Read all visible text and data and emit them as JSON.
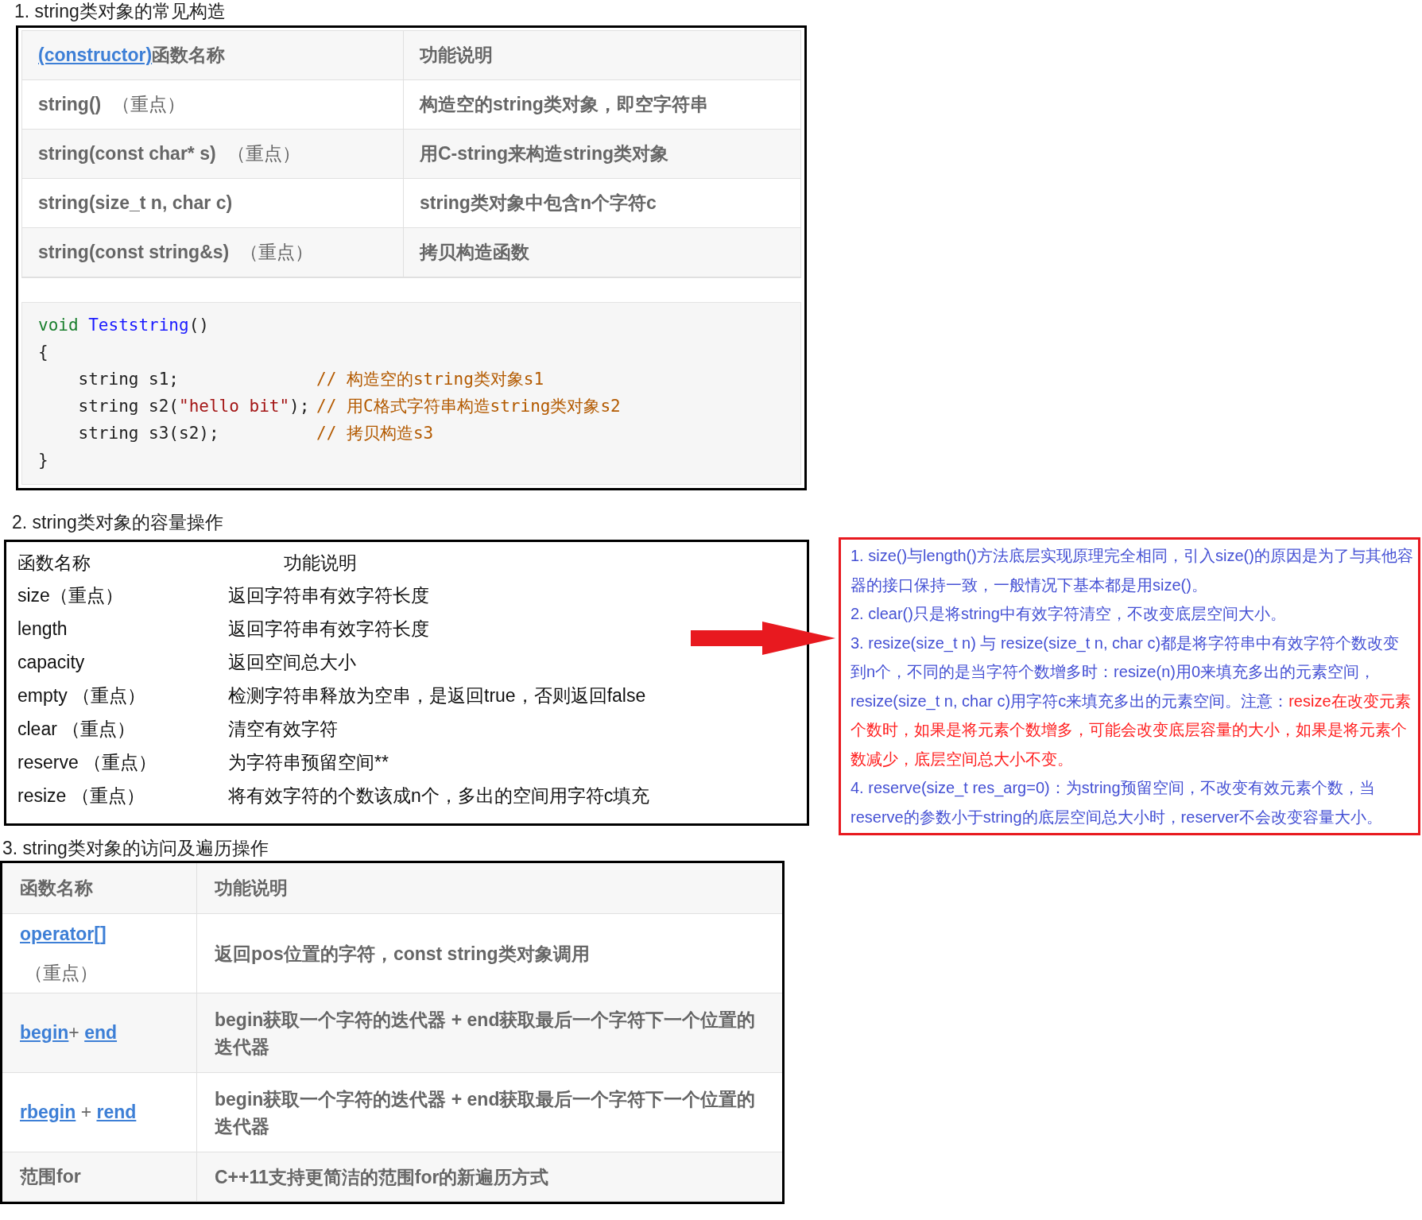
{
  "section_1": {
    "heading": "1. string类对象的常见构造",
    "table": {
      "header": {
        "link": "(constructor)",
        "name_rest": "函数名称",
        "description": "功能说明"
      },
      "rows": [
        {
          "name": "string()",
          "note": "（重点）",
          "description": "构造空的string类对象，即空字符串"
        },
        {
          "name": "string(const char* s)",
          "note": "（重点）",
          "description": "用C-string来构造string类对象"
        },
        {
          "name": "string(size_t n, char c)",
          "description": "string类对象中包含n个字符c"
        },
        {
          "name": "string(const string&s)",
          "note": "（重点）",
          "description": "拷贝构造函数"
        }
      ]
    },
    "code": [
      {
        "tokens": [
          {
            "kind": "keyword",
            "text": "void"
          },
          {
            "kind": "function",
            "text": "Teststring"
          },
          {
            "kind": "plain",
            "text": "()"
          }
        ]
      },
      {
        "tokens": [
          {
            "kind": "plain",
            "text": "{"
          }
        ]
      },
      {
        "tokens": [
          {
            "kind": "plain",
            "text": "    string s1;"
          }
        ],
        "comment": "// 构造空的string类对象s1"
      },
      {
        "tokens": [
          {
            "kind": "plain",
            "text": "    string s2("
          },
          {
            "kind": "string",
            "text": "\"hello bit\""
          },
          {
            "kind": "plain",
            "text": ");"
          }
        ],
        "comment": "// 用C格式字符串构造string类对象s2"
      },
      {
        "tokens": [
          {
            "kind": "plain",
            "text": "    string s3(s2);"
          }
        ],
        "comment": "// 拷贝构造s3"
      },
      {
        "tokens": [
          {
            "kind": "plain",
            "text": "}"
          }
        ]
      }
    ]
  },
  "section_2": {
    "heading": "2. string类对象的容量操作",
    "table": {
      "columns": [
        "函数名称",
        "功能说明"
      ],
      "rows": [
        {
          "name": "size（重点）",
          "description": "返回字符串有效字符长度"
        },
        {
          "name": "length",
          "description": "返回字符串有效字符长度"
        },
        {
          "name": "capacity",
          "description": "返回空间总大小"
        },
        {
          "name": "empty （重点）",
          "description": "检测字符串释放为空串，是返回true，否则返回false"
        },
        {
          "name": "clear （重点）",
          "description": "清空有效字符"
        },
        {
          "name": "reserve （重点）",
          "description": "为字符串预留空间**"
        },
        {
          "name": "resize （重点）",
          "description": "将有效字符的个数该成n个，多出的空间用字符c填充"
        }
      ]
    }
  },
  "notes": [
    {
      "segments": [
        {
          "text": "1. size()与length()方法底层实现原理完全相同，引入size()的原因是为了与其他容器的接口保持一致，一般情况下基本都是用size()。",
          "highlight": false
        }
      ]
    },
    {
      "segments": [
        {
          "text": "2. clear()只是将string中有效字符清空，不改变底层空间大小。",
          "highlight": false
        }
      ]
    },
    {
      "segments": [
        {
          "text": "3. resize(size_t n) 与 resize(size_t n, char c)都是将字符串中有效字符个数改变到n个，不同的是当字符个数增多时：resize(n)用0来填充多出的元素空间，resize(size_t n, char c)用字符c来填充多出的元素空间。注意：",
          "highlight": false
        },
        {
          "text": "resize在改变元素个数时，如果是将元素个数增多，可能会改变底层容量的大小，如果是将元素个数减少，底层空间总大小不变。",
          "highlight": true
        }
      ]
    },
    {
      "segments": [
        {
          "text": "4. reserve(size_t res_arg=0)：为string预留空间，不改变有效元素个数，当reserve的参数小于string的底层空间总大小时，reserver不会改变容量大小。",
          "highlight": false
        }
      ]
    }
  ],
  "section_3": {
    "heading": "3. string类对象的访问及遍历操作",
    "table": {
      "columns": [
        "函数名称",
        "功能说明"
      ],
      "rows": [
        {
          "name": [
            {
              "text": "operator[]",
              "link": true
            },
            {
              "text": " （重点）",
              "link": false
            }
          ],
          "description": "返回pos位置的字符，const string类对象调用"
        },
        {
          "name": [
            {
              "text": "begin",
              "link": true
            },
            {
              "text": "+ ",
              "link": false
            },
            {
              "text": "end",
              "link": true
            }
          ],
          "description": "begin获取一个字符的迭代器 + end获取最后一个字符下一个位置的迭代器"
        },
        {
          "name": [
            {
              "text": "rbegin",
              "link": true
            },
            {
              "text": " + ",
              "link": false
            },
            {
              "text": "rend",
              "link": true
            }
          ],
          "description": "begin获取一个字符的迭代器 + end获取最后一个字符下一个位置的迭代器"
        },
        {
          "name": [
            {
              "text": "范围for",
              "link": false
            }
          ],
          "description": "C++11支持更简洁的范围for的新遍历方式"
        }
      ]
    }
  }
}
